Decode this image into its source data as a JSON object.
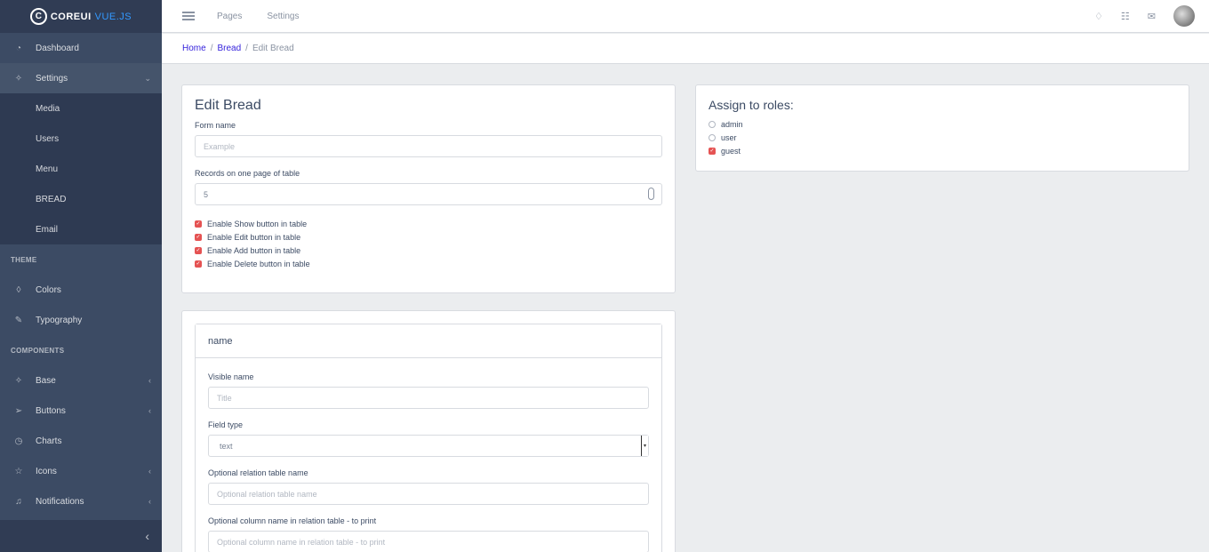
{
  "brand": {
    "logo": "C",
    "name_a": "COREUI",
    "name_b": "VUE.JS"
  },
  "sidebar": {
    "items": [
      {
        "label": "Dashboard",
        "icon": "speedometer-icon"
      },
      {
        "label": "Settings",
        "icon": "puzzle-icon"
      },
      {
        "label": "Media"
      },
      {
        "label": "Users"
      },
      {
        "label": "Menu"
      },
      {
        "label": "BREAD"
      },
      {
        "label": "Email"
      }
    ],
    "section_theme": "THEME",
    "theme_items": [
      {
        "label": "Colors",
        "icon": "drop-icon"
      },
      {
        "label": "Typography",
        "icon": "pencil-icon"
      }
    ],
    "section_components": "COMPONENTS",
    "component_items": [
      {
        "label": "Base",
        "icon": "puzzle-icon"
      },
      {
        "label": "Buttons",
        "icon": "cursor-icon"
      },
      {
        "label": "Charts",
        "icon": "chart-pie-icon"
      },
      {
        "label": "Icons",
        "icon": "star-icon"
      },
      {
        "label": "Notifications",
        "icon": "bell-icon"
      }
    ],
    "footer_glyph": "‹"
  },
  "header": {
    "nav": [
      "Pages",
      "Settings"
    ]
  },
  "breadcrumb": {
    "home": "Home",
    "bread": "Bread",
    "current": "Edit Bread",
    "sep": "/"
  },
  "edit": {
    "title": "Edit Bread",
    "form_name_label": "Form name",
    "form_name_placeholder": "Example",
    "records_label": "Records on one page of table",
    "records_value": "5",
    "checks": [
      "Enable Show button in table",
      "Enable Edit button in table",
      "Enable Add button in table",
      "Enable Delete button in table"
    ]
  },
  "roles": {
    "title": "Assign to roles:",
    "options": [
      "admin",
      "user",
      "guest"
    ]
  },
  "field": {
    "header": "name",
    "visible_label": "Visible name",
    "visible_placeholder": "Title",
    "type_label": "Field type",
    "type_value": "text",
    "relation_label": "Optional relation table name",
    "relation_placeholder": "Optional relation table name",
    "column_label": "Optional column name in relation table - to print",
    "column_placeholder": "Optional column name in relation table - to print"
  },
  "colors": {
    "sidebar": "#3c4b64",
    "accent": "#321fdb",
    "check": "#e55353"
  }
}
